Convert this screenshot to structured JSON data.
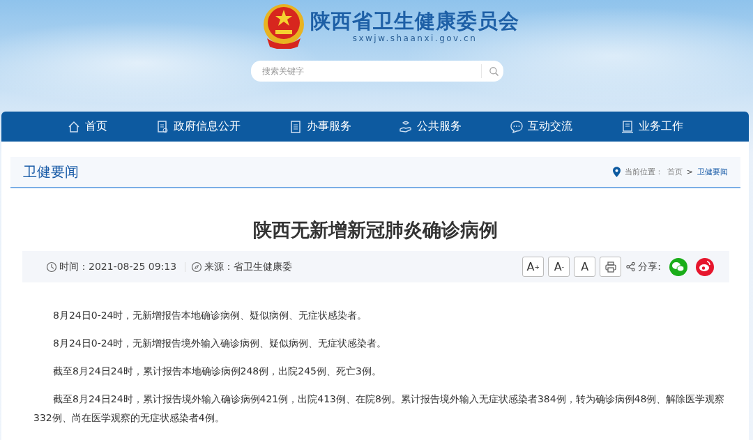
{
  "header": {
    "title": "陕西省卫生健康委员会",
    "domain": "sxwjw.shaanxi.gov.cn",
    "search": {
      "placeholder": "搜索关键字"
    }
  },
  "nav": [
    {
      "label": "首页"
    },
    {
      "label": "政府信息公开"
    },
    {
      "label": "办事服务"
    },
    {
      "label": "公共服务"
    },
    {
      "label": "互动交流"
    },
    {
      "label": "业务工作"
    }
  ],
  "section": {
    "title": "卫健要闻",
    "location_label": "当前位置：",
    "separator": ">",
    "crumbs": [
      {
        "label": "首页",
        "current": false
      },
      {
        "label": "卫健要闻",
        "current": true
      }
    ]
  },
  "article": {
    "title": "陕西无新增新冠肺炎确诊病例",
    "meta": {
      "time": "时间：2021-08-25 09:13",
      "source": "来源：省卫生健康委"
    },
    "font_buttons": [
      "A$^{+}$",
      "A$^{-}$",
      "A"
    ],
    "share_label": "分享:",
    "share": [
      {
        "kind": "wechat",
        "color": "#1aad19"
      },
      {
        "kind": "weibo",
        "color": "#e6162d"
      }
    ],
    "paragraphs": [
      "8月24日0-24时，无新增报告本地确诊病例、疑似病例、无症状感染者。",
      "8月24日0-24时，无新增报告境外输入确诊病例、疑似病例、无症状感染者。",
      "截至8月24日24时，累计报告本地确诊病例248例，出院245例、死亡3例。",
      "截至8月24日24时，累计报告境外输入确诊病例421例，出院413例、在院8例。累计报告境外输入无症状感染者384例，转为确诊病例48例、解除医学观察332例、尚在医学观察的无症状感染者4例。"
    ]
  }
}
